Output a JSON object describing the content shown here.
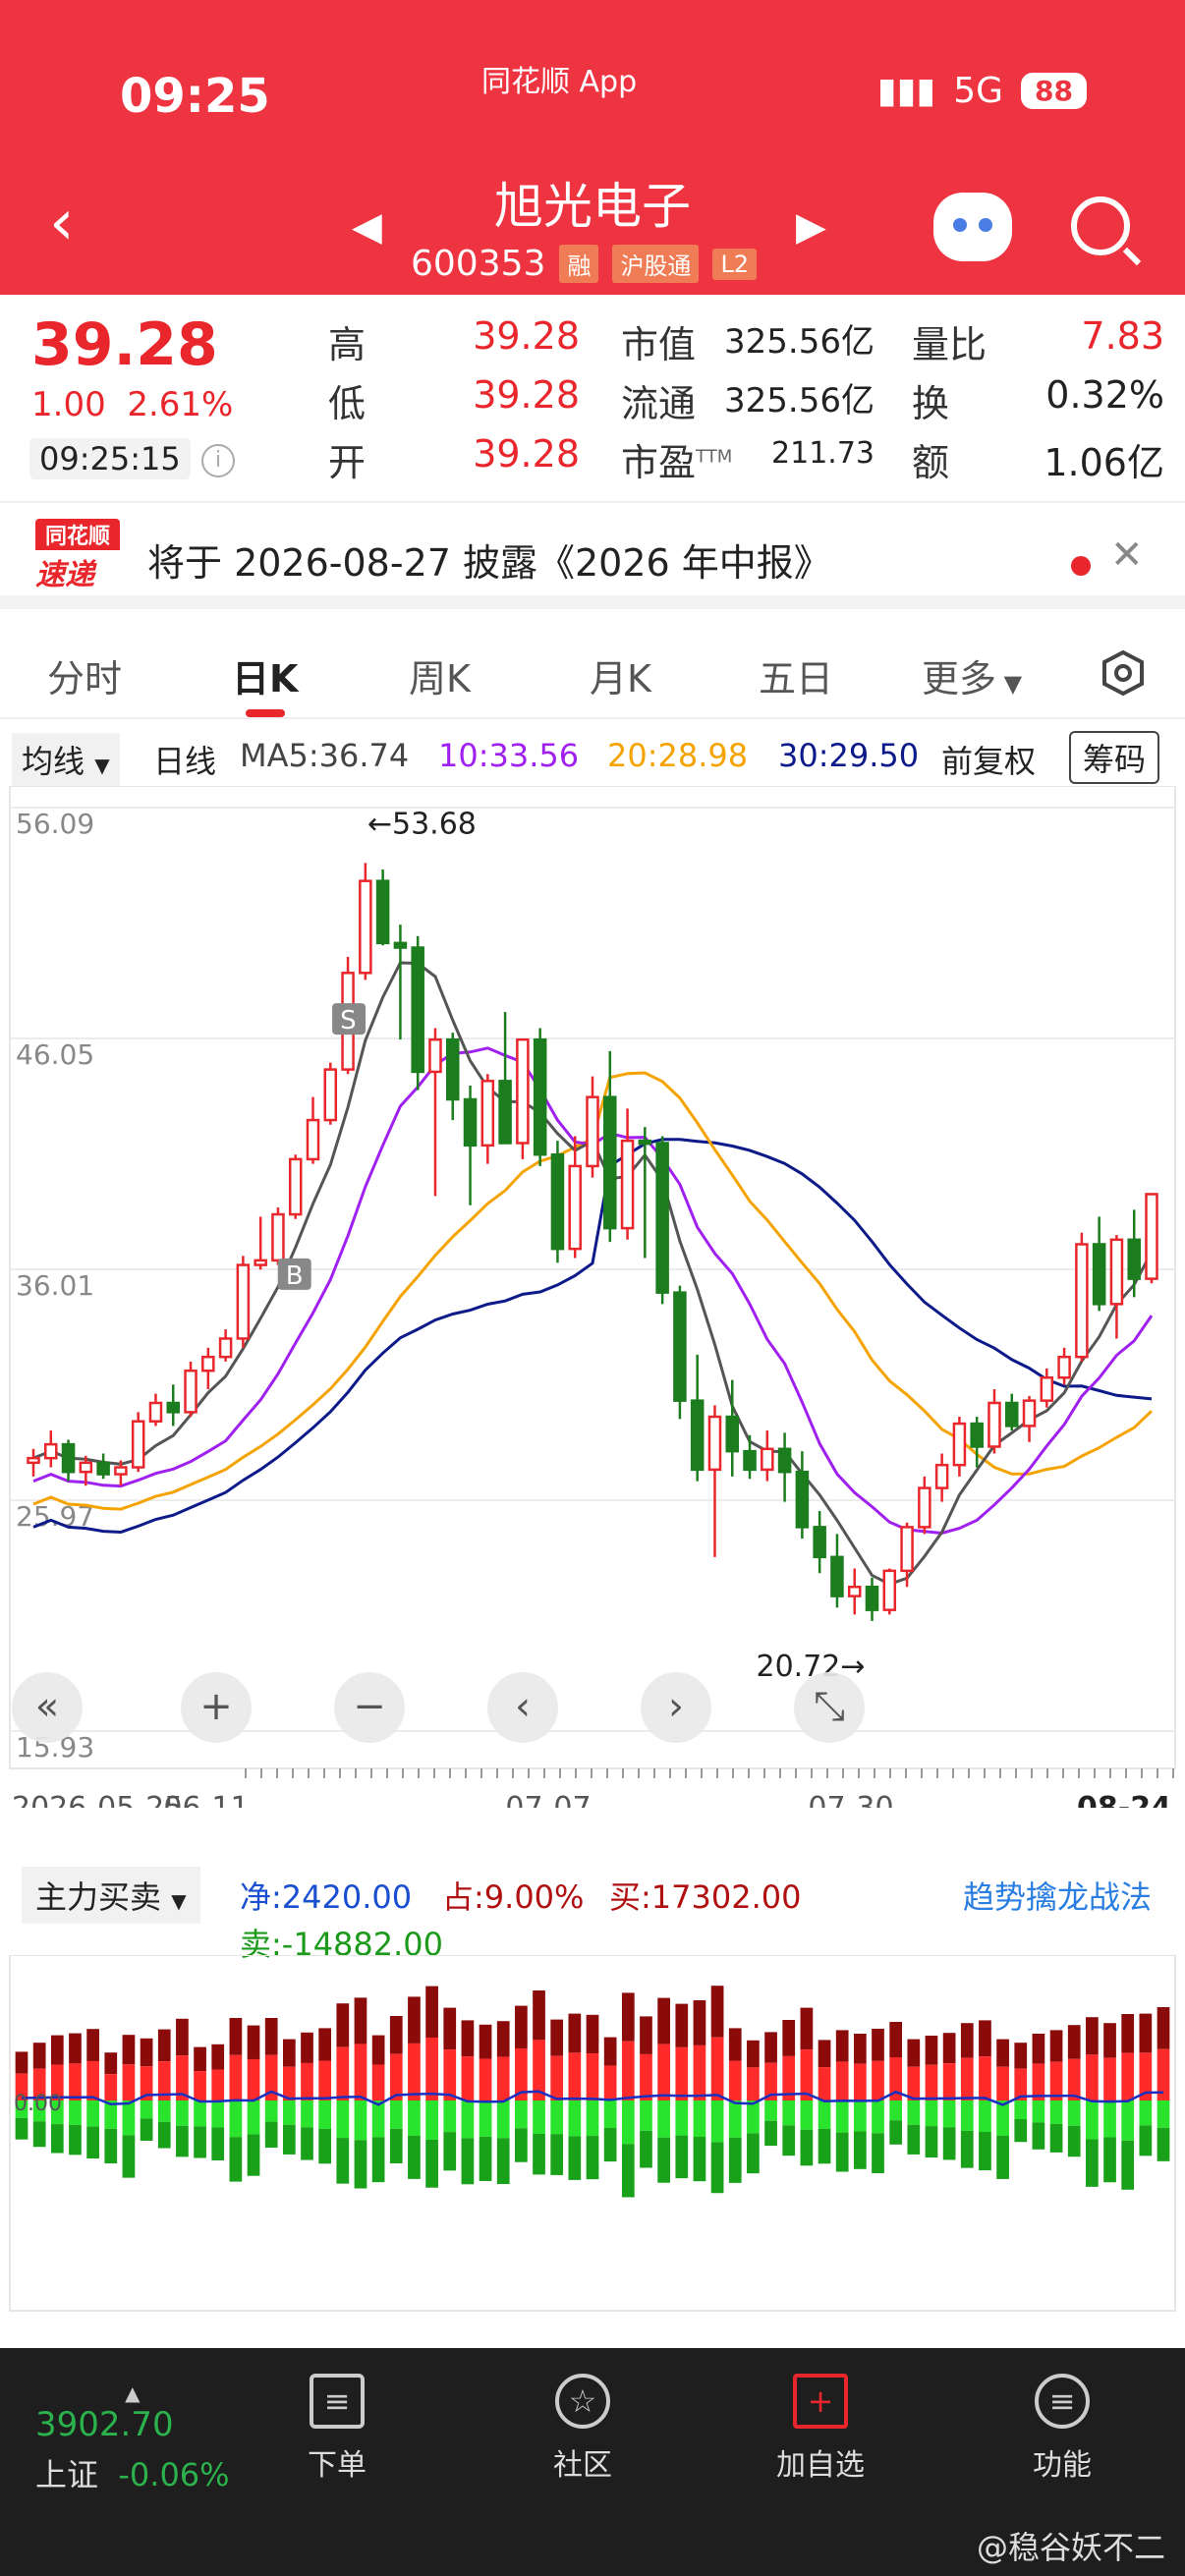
{
  "status": {
    "time": "09:25",
    "app": "同花顺 App",
    "network": "5G",
    "battery": "88"
  },
  "header": {
    "name": "旭光电子",
    "code": "600353",
    "tags": [
      "融",
      "沪股通",
      "L2"
    ]
  },
  "quote": {
    "price": "39.28",
    "change": "1.00",
    "pct": "2.61%",
    "time": "09:25:15",
    "high_label": "高",
    "high": "39.28",
    "low_label": "低",
    "low": "39.28",
    "open_label": "开",
    "open": "39.28",
    "mcap_label": "市值",
    "mcap": "325.56亿",
    "float_label": "流通",
    "float": "325.56亿",
    "pe_label": "市盈",
    "pe_sup": "TTM",
    "pe": "211.73",
    "vr_label": "量比",
    "vr": "7.83",
    "turn_label": "换",
    "turn": "0.32%",
    "amt_label": "额",
    "amt": "1.06亿"
  },
  "notice": {
    "logo_top": "同花顺",
    "logo_bottom": "速递",
    "text": "将于 2026-08-27 披露《2026 年中报》"
  },
  "tabs": [
    "分时",
    "日K",
    "周K",
    "月K",
    "五日",
    "更多"
  ],
  "ma": {
    "select": "均线",
    "type": "日线",
    "ma5": "MA5:36.74",
    "ma10": "10:33.56",
    "ma20": "20:28.98",
    "ma30": "30:29.50",
    "adj": "前复权",
    "chips": "筹码"
  },
  "chart_data": {
    "type": "candlestick",
    "y_ticks": [
      "56.09",
      "46.05",
      "36.01",
      "25.97",
      "15.93"
    ],
    "ylim": [
      15.93,
      56.09
    ],
    "x_ticks": [
      "2026-05-25",
      "06-11",
      "07-07",
      "07-30",
      "08-24"
    ],
    "annotations": {
      "high": "←53.68",
      "low": "20.72→",
      "buy": "B",
      "sell": "S"
    },
    "candles": [
      [
        27.6,
        28.2,
        27.0,
        27.8
      ],
      [
        27.8,
        29.0,
        27.4,
        28.4
      ],
      [
        28.4,
        28.6,
        26.8,
        27.2
      ],
      [
        27.2,
        27.9,
        26.6,
        27.6
      ],
      [
        27.6,
        28.0,
        26.9,
        27.1
      ],
      [
        27.1,
        27.7,
        26.6,
        27.4
      ],
      [
        27.4,
        29.8,
        27.2,
        29.4
      ],
      [
        29.4,
        30.6,
        29.2,
        30.2
      ],
      [
        30.2,
        31.0,
        29.2,
        29.8
      ],
      [
        29.8,
        32.0,
        29.6,
        31.6
      ],
      [
        31.6,
        32.6,
        30.8,
        32.2
      ],
      [
        32.2,
        33.4,
        32.0,
        33.0
      ],
      [
        33.0,
        36.6,
        32.6,
        36.2
      ],
      [
        36.2,
        38.3,
        36.0,
        36.4
      ],
      [
        36.4,
        38.7,
        36.2,
        38.4
      ],
      [
        38.4,
        41.0,
        38.2,
        40.8
      ],
      [
        40.8,
        43.5,
        40.6,
        42.5
      ],
      [
        42.5,
        45.0,
        42.3,
        44.7
      ],
      [
        44.7,
        49.6,
        44.5,
        48.9
      ],
      [
        48.9,
        53.68,
        48.6,
        52.9
      ],
      [
        52.9,
        53.4,
        50.1,
        50.2
      ],
      [
        50.2,
        51.0,
        46.0,
        50.0
      ],
      [
        50.0,
        50.5,
        43.8,
        44.6
      ],
      [
        44.6,
        46.5,
        39.2,
        46.0
      ],
      [
        46.0,
        46.3,
        42.5,
        43.4
      ],
      [
        43.4,
        44.0,
        38.8,
        41.4
      ],
      [
        41.4,
        44.5,
        40.6,
        44.2
      ],
      [
        44.2,
        47.2,
        43.6,
        41.5
      ],
      [
        41.5,
        45.6,
        40.8,
        46.0
      ],
      [
        46.0,
        46.5,
        40.5,
        41.0
      ],
      [
        41.0,
        41.6,
        36.3,
        36.9
      ],
      [
        36.9,
        41.8,
        36.5,
        40.5
      ],
      [
        40.5,
        44.4,
        40.0,
        43.5
      ],
      [
        43.5,
        45.5,
        37.2,
        37.8
      ],
      [
        37.8,
        43.0,
        37.3,
        41.6
      ],
      [
        41.6,
        42.2,
        36.5,
        41.5
      ],
      [
        41.5,
        41.8,
        34.5,
        35.0
      ],
      [
        35.0,
        35.3,
        29.5,
        30.3
      ],
      [
        30.3,
        32.3,
        26.8,
        27.3
      ],
      [
        27.3,
        30.1,
        23.5,
        29.6
      ],
      [
        29.6,
        31.2,
        27.0,
        28.1
      ],
      [
        28.1,
        28.8,
        26.9,
        27.3
      ],
      [
        27.3,
        29.0,
        26.8,
        28.2
      ],
      [
        28.2,
        28.9,
        25.9,
        27.2
      ],
      [
        27.2,
        28.1,
        24.3,
        24.8
      ],
      [
        24.8,
        25.5,
        22.8,
        23.5
      ],
      [
        23.5,
        24.5,
        21.3,
        21.8
      ],
      [
        21.8,
        23.0,
        21.0,
        22.2
      ],
      [
        22.2,
        22.6,
        20.72,
        21.2
      ],
      [
        21.2,
        23.0,
        21.0,
        22.9
      ],
      [
        22.9,
        25.0,
        22.2,
        24.8
      ],
      [
        24.8,
        27.0,
        24.5,
        26.5
      ],
      [
        26.5,
        28.0,
        25.9,
        27.5
      ],
      [
        27.5,
        29.6,
        27.0,
        29.3
      ],
      [
        29.3,
        29.6,
        27.4,
        28.3
      ],
      [
        28.3,
        30.8,
        28.0,
        30.2
      ],
      [
        30.2,
        30.6,
        29.0,
        29.2
      ],
      [
        29.2,
        30.5,
        28.5,
        30.3
      ],
      [
        30.3,
        31.7,
        30.0,
        31.3
      ],
      [
        31.3,
        32.6,
        31.0,
        32.2
      ],
      [
        32.2,
        37.6,
        32.0,
        37.1
      ],
      [
        37.1,
        38.3,
        34.2,
        34.5
      ],
      [
        34.5,
        37.5,
        33.0,
        37.3
      ],
      [
        37.3,
        38.6,
        34.8,
        35.6
      ],
      [
        35.6,
        39.28,
        35.4,
        39.28
      ]
    ]
  },
  "flow": {
    "select": "主力买卖",
    "net": "净:2420.00",
    "ratio": "占:9.00%",
    "buy": "买:17302.00",
    "sell": "卖:-14882.00",
    "strategy": "趋势擒龙战法",
    "zero": "0.00"
  },
  "footer": {
    "index_val": "3902.70",
    "index_name": "上证",
    "index_pct": "-0.06%",
    "items": [
      "下单",
      "社区",
      "加自选",
      "功能"
    ],
    "watermark": "@稳谷妖不二"
  },
  "colors": {
    "up": "#e8262b",
    "down": "#1c7d1f",
    "ma5": "#555555",
    "ma10": "#a020f0",
    "ma20": "#f5a300",
    "ma30": "#0d1a8a"
  }
}
